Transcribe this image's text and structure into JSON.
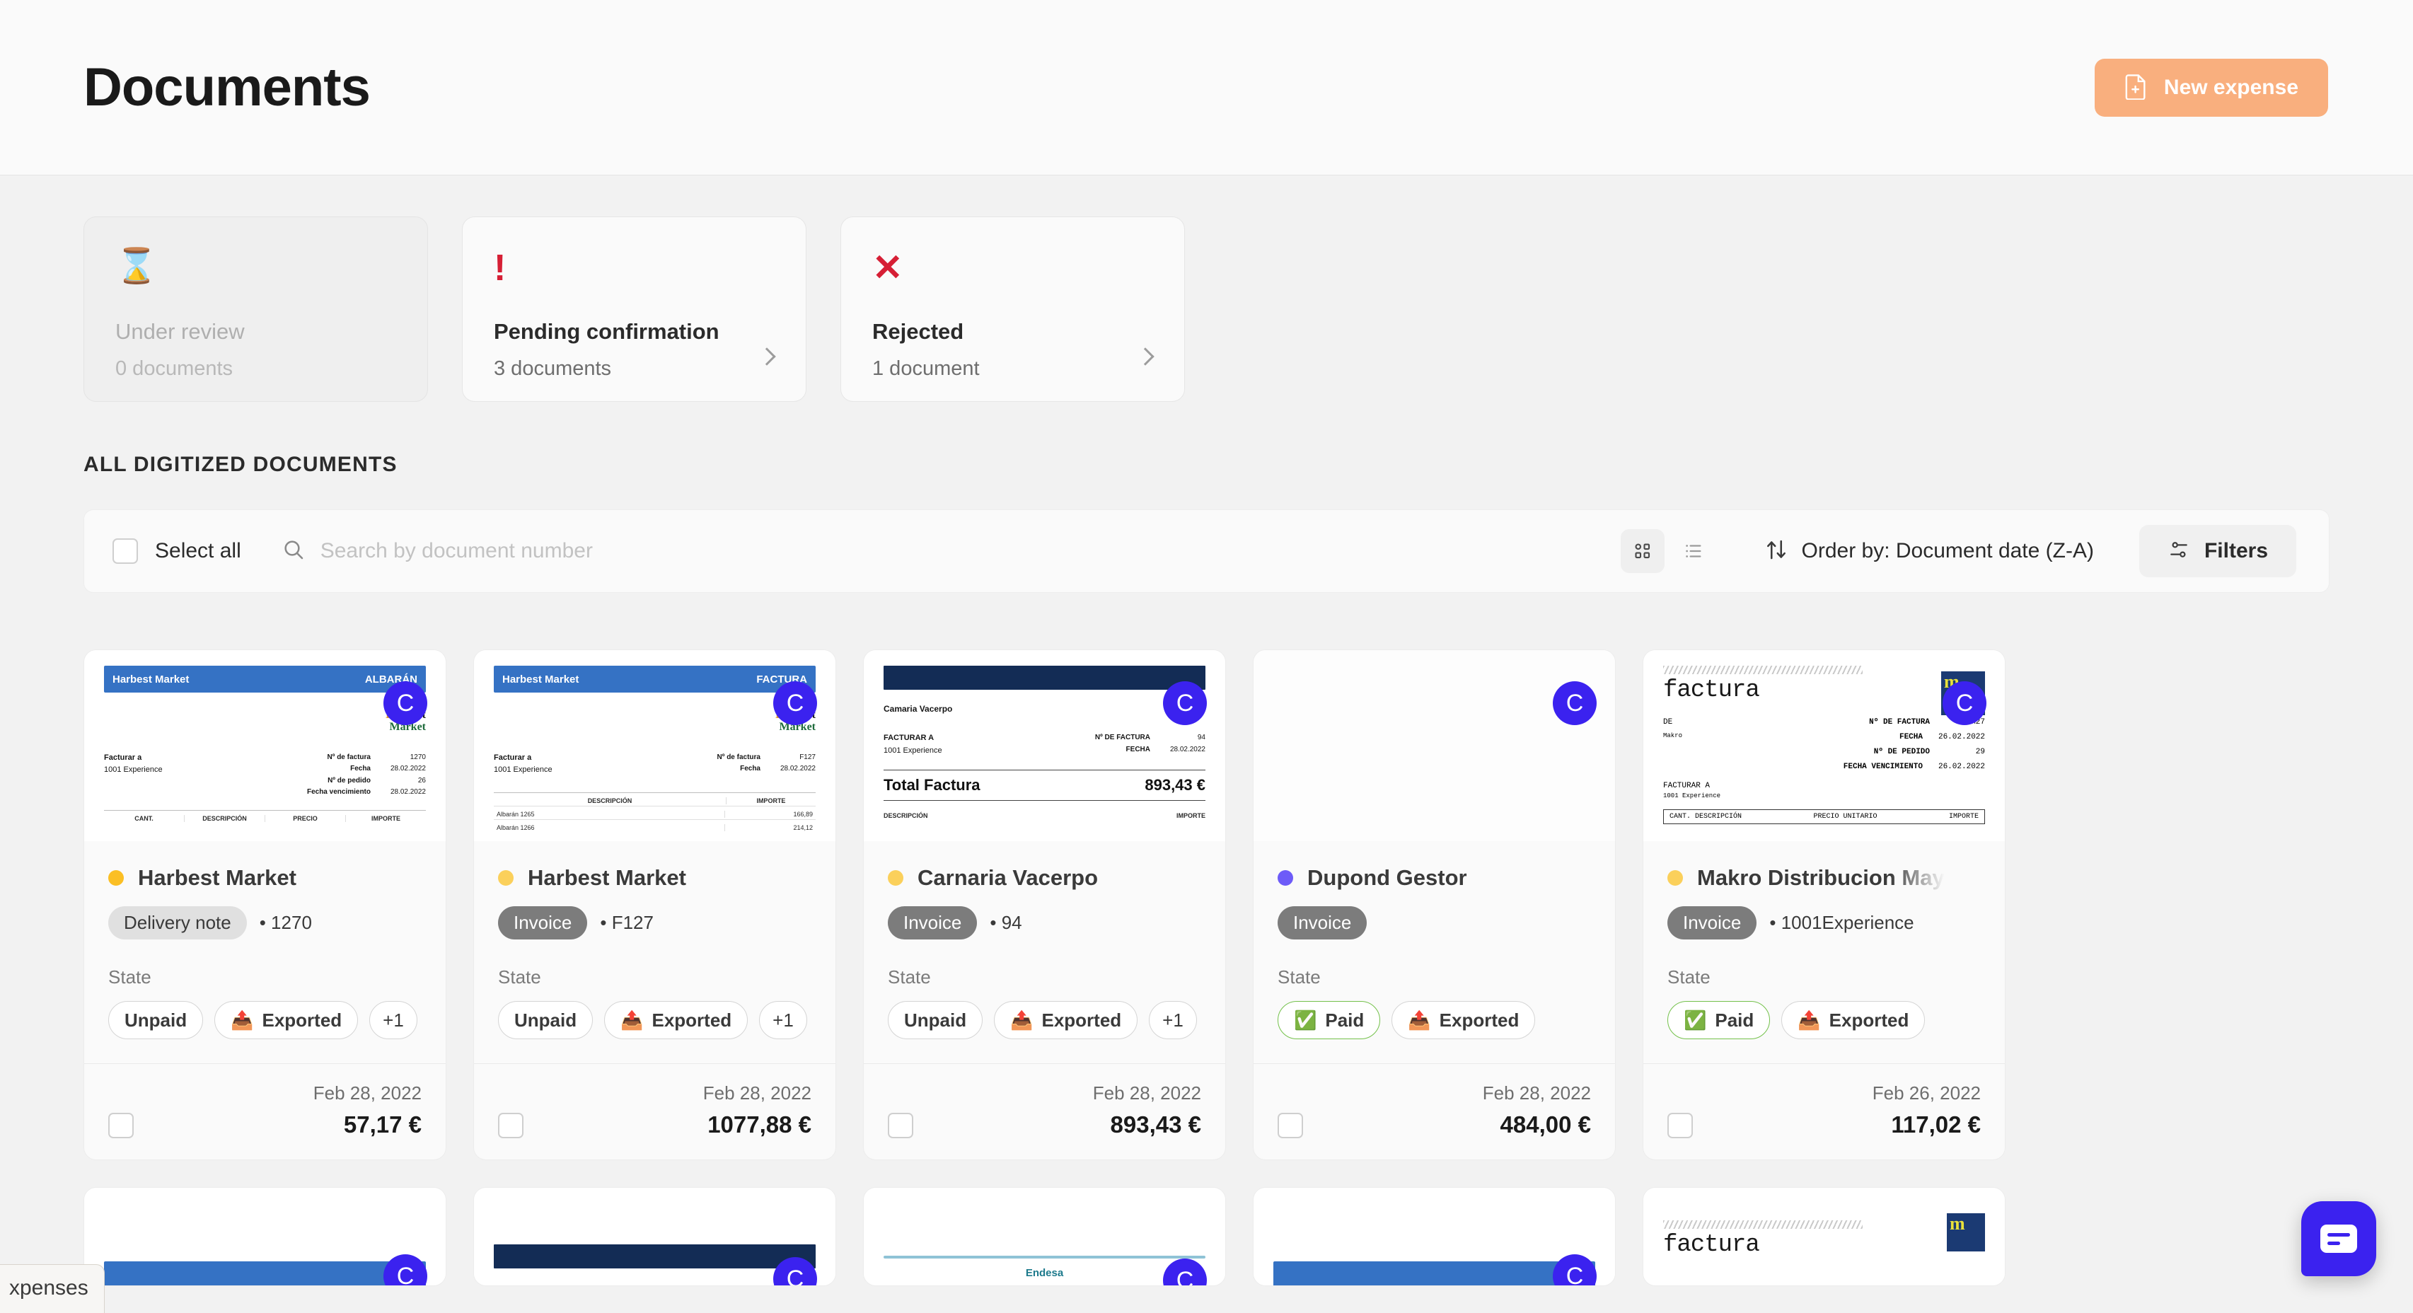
{
  "header": {
    "title": "Documents",
    "new_expense_label": "New expense"
  },
  "status_cards": [
    {
      "icon": "hourglass-icon",
      "glyph": "⌛",
      "title": "Under review",
      "subtitle": "0 documents",
      "disabled": true,
      "has_chevron": false
    },
    {
      "icon": "exclamation-icon",
      "glyph": "!",
      "title": "Pending confirmation",
      "subtitle": "3 documents",
      "disabled": false,
      "has_chevron": true
    },
    {
      "icon": "cross-icon",
      "glyph": "✕",
      "title": "Rejected",
      "subtitle": "1 document",
      "disabled": false,
      "has_chevron": true
    }
  ],
  "section": {
    "title": "ALL DIGITIZED DOCUMENTS"
  },
  "toolbar": {
    "select_all_label": "Select all",
    "search_placeholder": "Search by document number",
    "search_value": "",
    "grid_view_label": "grid-view",
    "list_view_label": "list-view",
    "order_by_label": "Order by: Document date (Z-A)",
    "filters_label": "Filters"
  },
  "colors": {
    "accent_orange": "#F9AF7E",
    "avatar_blue": "#3B22EF",
    "status_yellow": "#FBBF24",
    "status_purple": "#6D5BF8",
    "paid_green": "#74C14B",
    "red": "#D61F35"
  },
  "cards": [
    {
      "avatar": "C",
      "dot_color": "#FBBF24",
      "title": "Harbest Market",
      "truncated": false,
      "type_label": "Delivery note",
      "type_style": "delivery",
      "doc_number": "• 1270",
      "state_label": "State",
      "chips": [
        {
          "label": "Unpaid",
          "icon": "",
          "style": "plain"
        },
        {
          "label": "Exported",
          "icon": "📤",
          "style": "plain"
        },
        {
          "label": "+1",
          "icon": "",
          "style": "plus"
        }
      ],
      "date": "Feb 28, 2022",
      "amount": "57,17 €",
      "thumb": {
        "kind": "harbest-albaran",
        "bar_left": "Harbest Market",
        "bar_right": "ALBARÁN",
        "logo_har": "Har",
        "logo_best": "Best",
        "logo_market": "Market",
        "bill_to_label": "Facturar a",
        "bill_to_value": "1001 Experience",
        "rows": [
          {
            "k": "Nº de factura",
            "v": "1270"
          },
          {
            "k": "Fecha",
            "v": "28.02.2022"
          },
          {
            "k": "Nº de pedido",
            "v": "26"
          },
          {
            "k": "Fecha vencimiento",
            "v": "28.02.2022"
          }
        ],
        "table_cols": [
          "CANT.",
          "DESCRIPCIÓN",
          "PRECIO",
          "IMPORTE"
        ]
      }
    },
    {
      "avatar": "C",
      "dot_color": "#FBD05B",
      "title": "Harbest Market",
      "truncated": false,
      "type_label": "Invoice",
      "type_style": "invoice",
      "doc_number": "• F127",
      "state_label": "State",
      "chips": [
        {
          "label": "Unpaid",
          "icon": "",
          "style": "plain"
        },
        {
          "label": "Exported",
          "icon": "📤",
          "style": "plain"
        },
        {
          "label": "+1",
          "icon": "",
          "style": "plus"
        }
      ],
      "date": "Feb 28, 2022",
      "amount": "1077,88 €",
      "thumb": {
        "kind": "harbest-factura",
        "bar_left": "Harbest Market",
        "bar_right": "FACTURA",
        "logo_har": "Har",
        "logo_best": "Best",
        "logo_market": "Market",
        "bill_to_label": "Facturar a",
        "bill_to_value": "1001 Experience",
        "rows": [
          {
            "k": "Nº de factura",
            "v": "F127"
          },
          {
            "k": "Fecha",
            "v": "28.02.2022"
          }
        ],
        "table_cols": [
          "DESCRIPCIÓN",
          "IMPORTE"
        ],
        "lines": [
          {
            "desc": "Albarán 1265",
            "amount": "166,89"
          },
          {
            "desc": "Albarán 1266",
            "amount": "214,12"
          }
        ]
      }
    },
    {
      "avatar": "C",
      "dot_color": "#FBD05B",
      "title": "Carnaria Vacerpo",
      "truncated": false,
      "type_label": "Invoice",
      "type_style": "invoice",
      "doc_number": "• 94",
      "state_label": "State",
      "chips": [
        {
          "label": "Unpaid",
          "icon": "",
          "style": "plain"
        },
        {
          "label": "Exported",
          "icon": "📤",
          "style": "plain"
        },
        {
          "label": "+1",
          "icon": "",
          "style": "plus"
        }
      ],
      "date": "Feb 28, 2022",
      "amount": "893,43 €",
      "thumb": {
        "kind": "carnaria",
        "company": "Camaria Vacerpo",
        "bill_to_label": "FACTURAR A",
        "bill_to_value": "1001 Experience",
        "rows": [
          {
            "k": "Nº DE FACTURA",
            "v": "94"
          },
          {
            "k": "FECHA",
            "v": "28.02.2022"
          }
        ],
        "total_label": "Total Factura",
        "total_value": "893,43 €",
        "table_cols": [
          "DESCRIPCIÓN",
          "IMPORTE"
        ]
      }
    },
    {
      "avatar": "C",
      "dot_color": "#6D5BF8",
      "title": "Dupond Gestor",
      "truncated": false,
      "type_label": "Invoice",
      "type_style": "invoice",
      "doc_number": "",
      "state_label": "State",
      "chips": [
        {
          "label": "Paid",
          "icon": "✅",
          "style": "paid"
        },
        {
          "label": "Exported",
          "icon": "📤",
          "style": "plain"
        }
      ],
      "date": "Feb 28, 2022",
      "amount": "484,00 €",
      "thumb": {
        "kind": "blank"
      }
    },
    {
      "avatar": "C",
      "dot_color": "#FBD05B",
      "title": "Makro Distribucion May",
      "truncated": true,
      "type_label": "Invoice",
      "type_style": "invoice",
      "doc_number": "• 1001Experience",
      "state_label": "State",
      "chips": [
        {
          "label": "Paid",
          "icon": "✅",
          "style": "paid"
        },
        {
          "label": "Exported",
          "icon": "📤",
          "style": "plain"
        }
      ],
      "date": "Feb 26, 2022",
      "amount": "117,02 €",
      "thumb": {
        "kind": "makro",
        "heading": "factura",
        "from_label": "DE",
        "from_value": "Makro",
        "bill_to_label": "FACTURAR A",
        "bill_to_value": "1001 Experience",
        "rows": [
          {
            "k": "Nº DE FACTURA",
            "v": "M27"
          },
          {
            "k": "FECHA",
            "v": "26.02.2022"
          },
          {
            "k": "Nº DE PEDIDO",
            "v": "29"
          },
          {
            "k": "FECHA VENCIMIENTO",
            "v": "26.02.2022"
          }
        ],
        "table_left": "CANT. DESCRIPCIÓN",
        "table_mid": "PRECIO UNITARIO",
        "table_right": "IMPORTE"
      }
    }
  ],
  "next_row_thumbs": [
    {
      "kind": "harbest",
      "avatar": "C"
    },
    {
      "kind": "carnaria",
      "avatar": "C"
    },
    {
      "kind": "endesa",
      "label": "Endesa",
      "avatar": "C"
    },
    {
      "kind": "harbest",
      "avatar": "C"
    },
    {
      "kind": "makro",
      "label": "factura",
      "avatar": "C"
    }
  ],
  "floating": {
    "expenses_tab_label": "xpenses",
    "chat_label": "chat"
  }
}
